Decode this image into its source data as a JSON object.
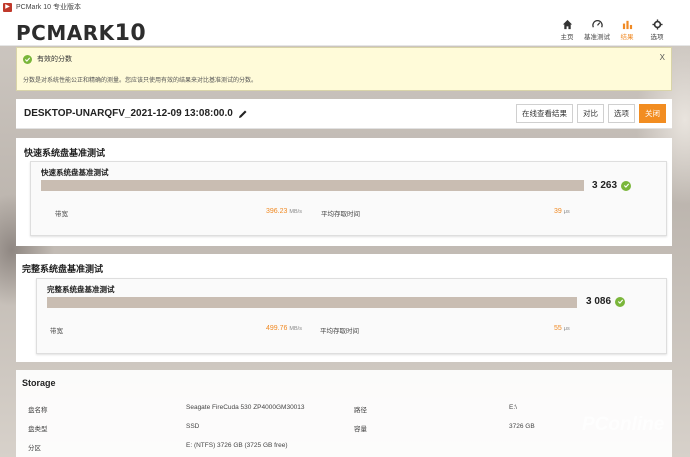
{
  "window": {
    "title": "PCMark 10 专业版本",
    "icon": "PCMark-app-icon"
  },
  "header": {
    "logo_main": "PCMARK",
    "logo_num": "10",
    "nav": [
      {
        "label": "主页",
        "icon": "home-icon"
      },
      {
        "label": "基准测试",
        "icon": "gauge-icon"
      },
      {
        "label": "结果",
        "icon": "bar-chart-icon",
        "active": true
      },
      {
        "label": "选项",
        "icon": "gear-icon"
      }
    ]
  },
  "notice": {
    "title": "有效的分数",
    "body": "分数是对系统性能公正和精确的测量。您应该只使用有效的结果来对比基准测试的分数。",
    "close": "X"
  },
  "result": {
    "title": "DESKTOP-UNARQFV_2021-12-09 13:08:00.0",
    "buttons": {
      "online": "在线查看结果",
      "compare": "对比",
      "options": "选项",
      "close": "关闭"
    }
  },
  "quick": {
    "section_title": "快速系统盘基准测试",
    "inner_title": "快速系统盘基准测试",
    "score": "3 263",
    "bandwidth_label": "带宽",
    "bandwidth_value": "396.23",
    "bandwidth_unit": "MB/s",
    "latency_label": "平均存取时间",
    "latency_value": "39",
    "latency_unit": "μs"
  },
  "full": {
    "section_title": "完整系统盘基准测试",
    "inner_title": "完整系统盘基准测试",
    "score": "3 086",
    "bandwidth_label": "带宽",
    "bandwidth_value": "499.76",
    "bandwidth_unit": "MB/s",
    "latency_label": "平均存取时间",
    "latency_value": "55",
    "latency_unit": "μs"
  },
  "storage": {
    "title": "Storage",
    "rows": [
      {
        "label": "盘名称",
        "value": "Seagate FireCuda 530 ZP4000GM30013",
        "label2": "路径",
        "value2": "E:\\"
      },
      {
        "label": "盘类型",
        "value": "SSD",
        "label2": "容量",
        "value2": "3726 GB"
      },
      {
        "label": "分区",
        "value": "E: (NTFS) 3726 GB (3725 GB free)"
      }
    ]
  },
  "watermark": "PConline",
  "colors": {
    "accent": "#f28d21",
    "ok": "#7ab63a",
    "bar": "#c9bdb2"
  }
}
